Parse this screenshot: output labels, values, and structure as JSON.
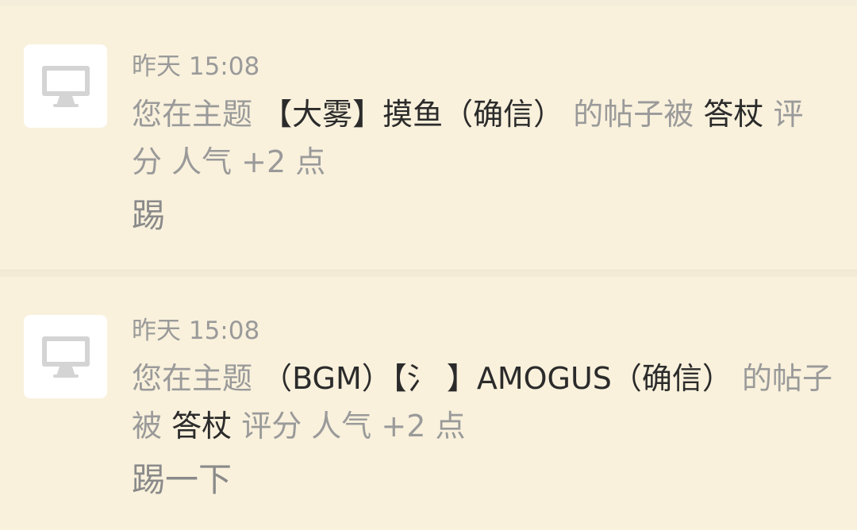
{
  "notifications": [
    {
      "time": "昨天 15:08",
      "prefix": "您在主题",
      "thread_title": "【大雾】摸鱼（确信）",
      "middle": "的帖子被",
      "rater": "答杖",
      "suffix": "评分 人气 +2 点",
      "reason": "踢",
      "icon": "computer-icon"
    },
    {
      "time": "昨天 15:08",
      "prefix": "您在主题",
      "thread_title": "（BGM）【氵 】AMOGUS（确信）",
      "middle": "的帖子被",
      "rater": "答杖",
      "suffix": "评分 人气 +2 点",
      "reason": "踢一下",
      "icon": "computer-icon"
    }
  ],
  "colors": {
    "background": "#f9f1dc",
    "muted_text": "#9a9a9a",
    "emphasis_text": "#2b2b2b",
    "avatar_bg": "#ffffff",
    "icon_gray": "#d4d4d4"
  }
}
